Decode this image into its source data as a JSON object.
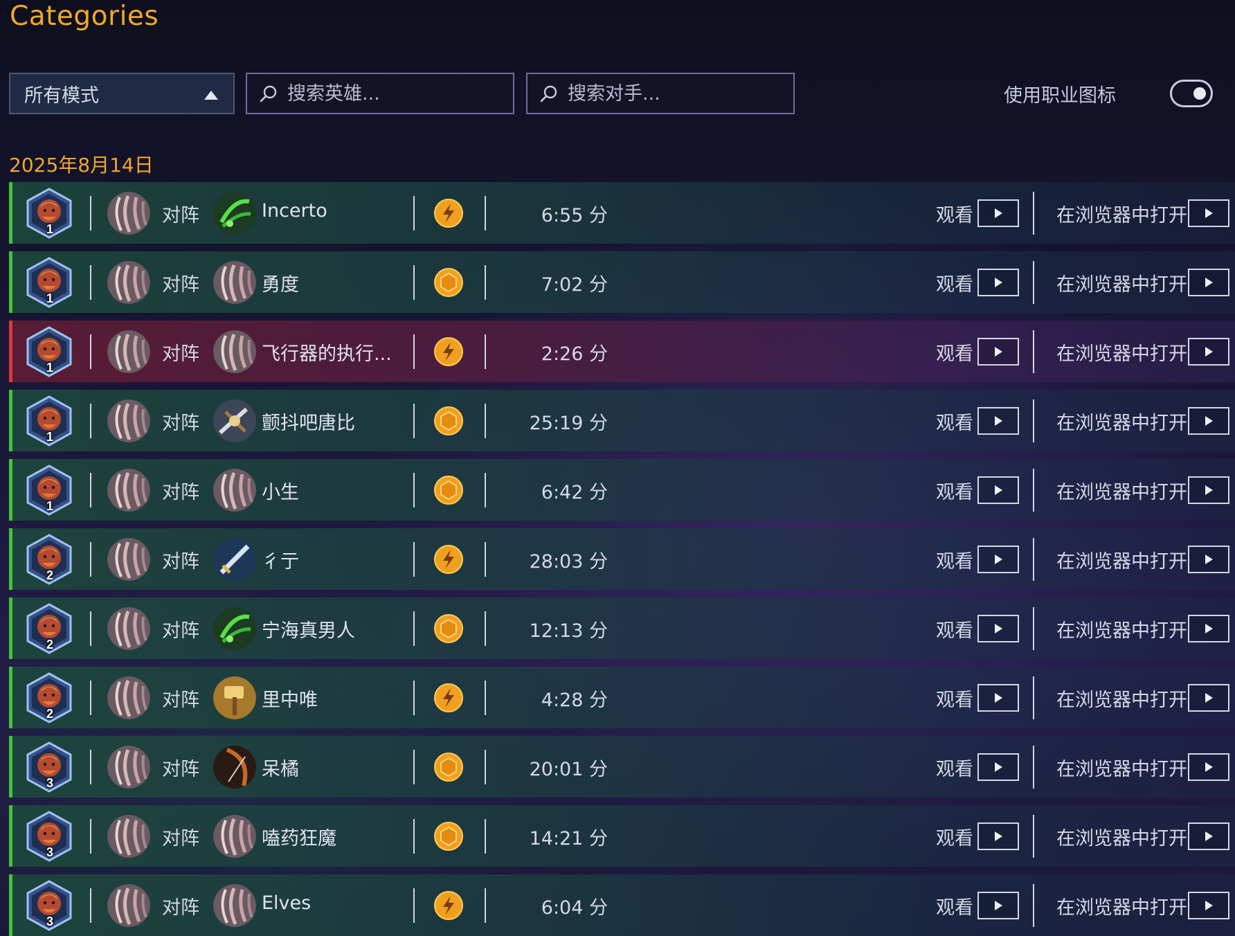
{
  "header": {
    "title": "Categories"
  },
  "filters": {
    "mode_select_value": "所有模式",
    "hero_search_placeholder": "搜索英雄...",
    "opponent_search_placeholder": "搜索对手...",
    "class_icon_toggle_label": "使用职业图标",
    "class_icon_toggle_on": true
  },
  "date_heading": "2025年8月14日",
  "colors": {
    "accent": "#f2a82a",
    "win": "#3fc43a",
    "loss": "#d83a3a"
  },
  "labels": {
    "vs": "对阵",
    "watch": "观看",
    "open_in_browser": "在浏览器中打开"
  },
  "matches": [
    {
      "rank": "1",
      "result": "win",
      "opponent": "Incerto",
      "opponent_icon": "green-claw-icon",
      "mode_icon": "standard-mode-icon",
      "duration": "6:55 分"
    },
    {
      "rank": "1",
      "result": "win",
      "opponent": "勇度",
      "opponent_icon": "default-hero-icon",
      "mode_icon": "casual-mode-icon",
      "duration": "7:02 分"
    },
    {
      "rank": "1",
      "result": "loss",
      "opponent": "飞行器的执行...",
      "opponent_icon": "default-hero-icon",
      "mode_icon": "standard-mode-icon",
      "duration": "2:26 分"
    },
    {
      "rank": "1",
      "result": "win",
      "opponent": "颤抖吧唐比",
      "opponent_icon": "silver-knight-icon",
      "mode_icon": "casual-mode-icon",
      "duration": "25:19 分"
    },
    {
      "rank": "1",
      "result": "win",
      "opponent": "小生",
      "opponent_icon": "default-hero-icon",
      "mode_icon": "casual-mode-icon",
      "duration": "6:42 分"
    },
    {
      "rank": "2",
      "result": "win",
      "opponent": "彳亍",
      "opponent_icon": "blue-sword-icon",
      "mode_icon": "standard-mode-icon",
      "duration": "28:03 分"
    },
    {
      "rank": "2",
      "result": "win",
      "opponent": "宁海真男人",
      "opponent_icon": "green-claw-icon",
      "mode_icon": "casual-mode-icon",
      "duration": "12:13 分"
    },
    {
      "rank": "2",
      "result": "win",
      "opponent": "里中唯",
      "opponent_icon": "golden-hammer-icon",
      "mode_icon": "standard-mode-icon",
      "duration": "4:28 分"
    },
    {
      "rank": "3",
      "result": "win",
      "opponent": "呆橘",
      "opponent_icon": "dark-bow-icon",
      "mode_icon": "casual-mode-icon",
      "duration": "20:01 分"
    },
    {
      "rank": "3",
      "result": "win",
      "opponent": "嗑药狂魔",
      "opponent_icon": "default-hero-icon",
      "mode_icon": "casual-mode-icon",
      "duration": "14:21 分"
    },
    {
      "rank": "3",
      "result": "win",
      "opponent": "Elves",
      "opponent_icon": "default-hero-icon",
      "mode_icon": "standard-mode-icon",
      "duration": "6:04 分"
    }
  ]
}
